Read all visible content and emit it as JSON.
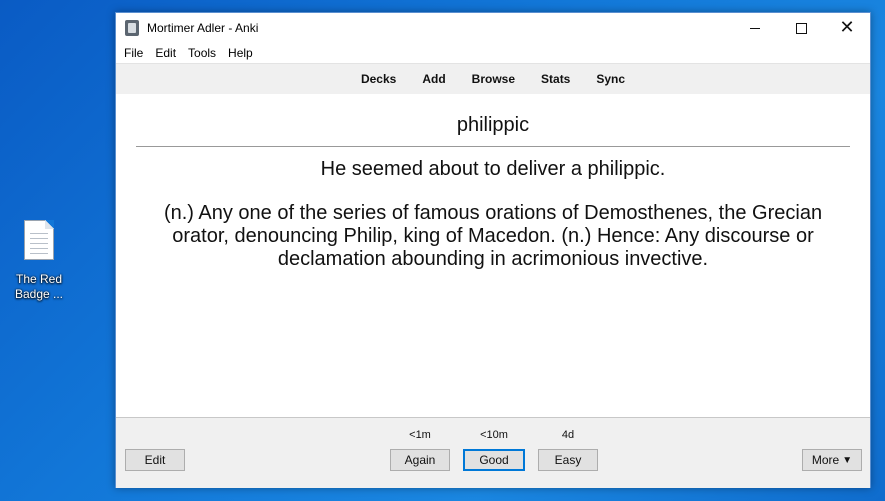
{
  "desktop": {
    "icon_label_line1": "The Red",
    "icon_label_line2": "Badge ..."
  },
  "window": {
    "title": "Mortimer Adler - Anki",
    "controls": {
      "minimize": "—",
      "maximize": "☐",
      "close": "✕"
    }
  },
  "menu": [
    "File",
    "Edit",
    "Tools",
    "Help"
  ],
  "toolbar": [
    "Decks",
    "Add",
    "Browse",
    "Stats",
    "Sync"
  ],
  "card": {
    "front": "philippic",
    "example": "He seemed about to deliver a philippic.",
    "definition": "(n.) Any one of the series of famous orations of Demosthenes, the Grecian orator, denouncing Philip, king of Macedon. (n.) Hence: Any discourse or declamation abounding in acrimonious invective."
  },
  "answer_buttons": [
    {
      "interval": "<1m",
      "label": "Again"
    },
    {
      "interval": "<10m",
      "label": "Good"
    },
    {
      "interval": "4d",
      "label": "Easy"
    }
  ],
  "edit_label": "Edit",
  "more_label": "More",
  "more_arrow": "▼"
}
